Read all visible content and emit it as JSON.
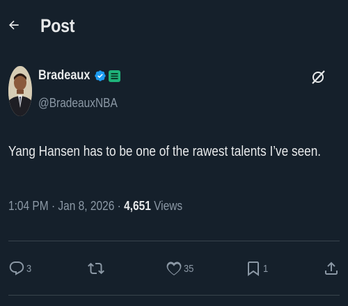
{
  "header": {
    "title": "Post"
  },
  "author": {
    "name": "Bradeaux",
    "handle": "@BradeauxNBA"
  },
  "tweet": {
    "text": "Yang Hansen has to be one of the rawest talents I’ve seen.",
    "time": "1:04 PM",
    "date": "Jan 8, 2026",
    "views": "4,651",
    "views_label": "Views"
  },
  "actions": {
    "replies": "3",
    "retweets": "",
    "likes": "35",
    "bookmarks": "1"
  },
  "colors": {
    "background": "#15202b",
    "text": "#e7e9ea",
    "secondary": "#8b98a5",
    "verified": "#1d9bf0",
    "divider": "#38444d"
  }
}
